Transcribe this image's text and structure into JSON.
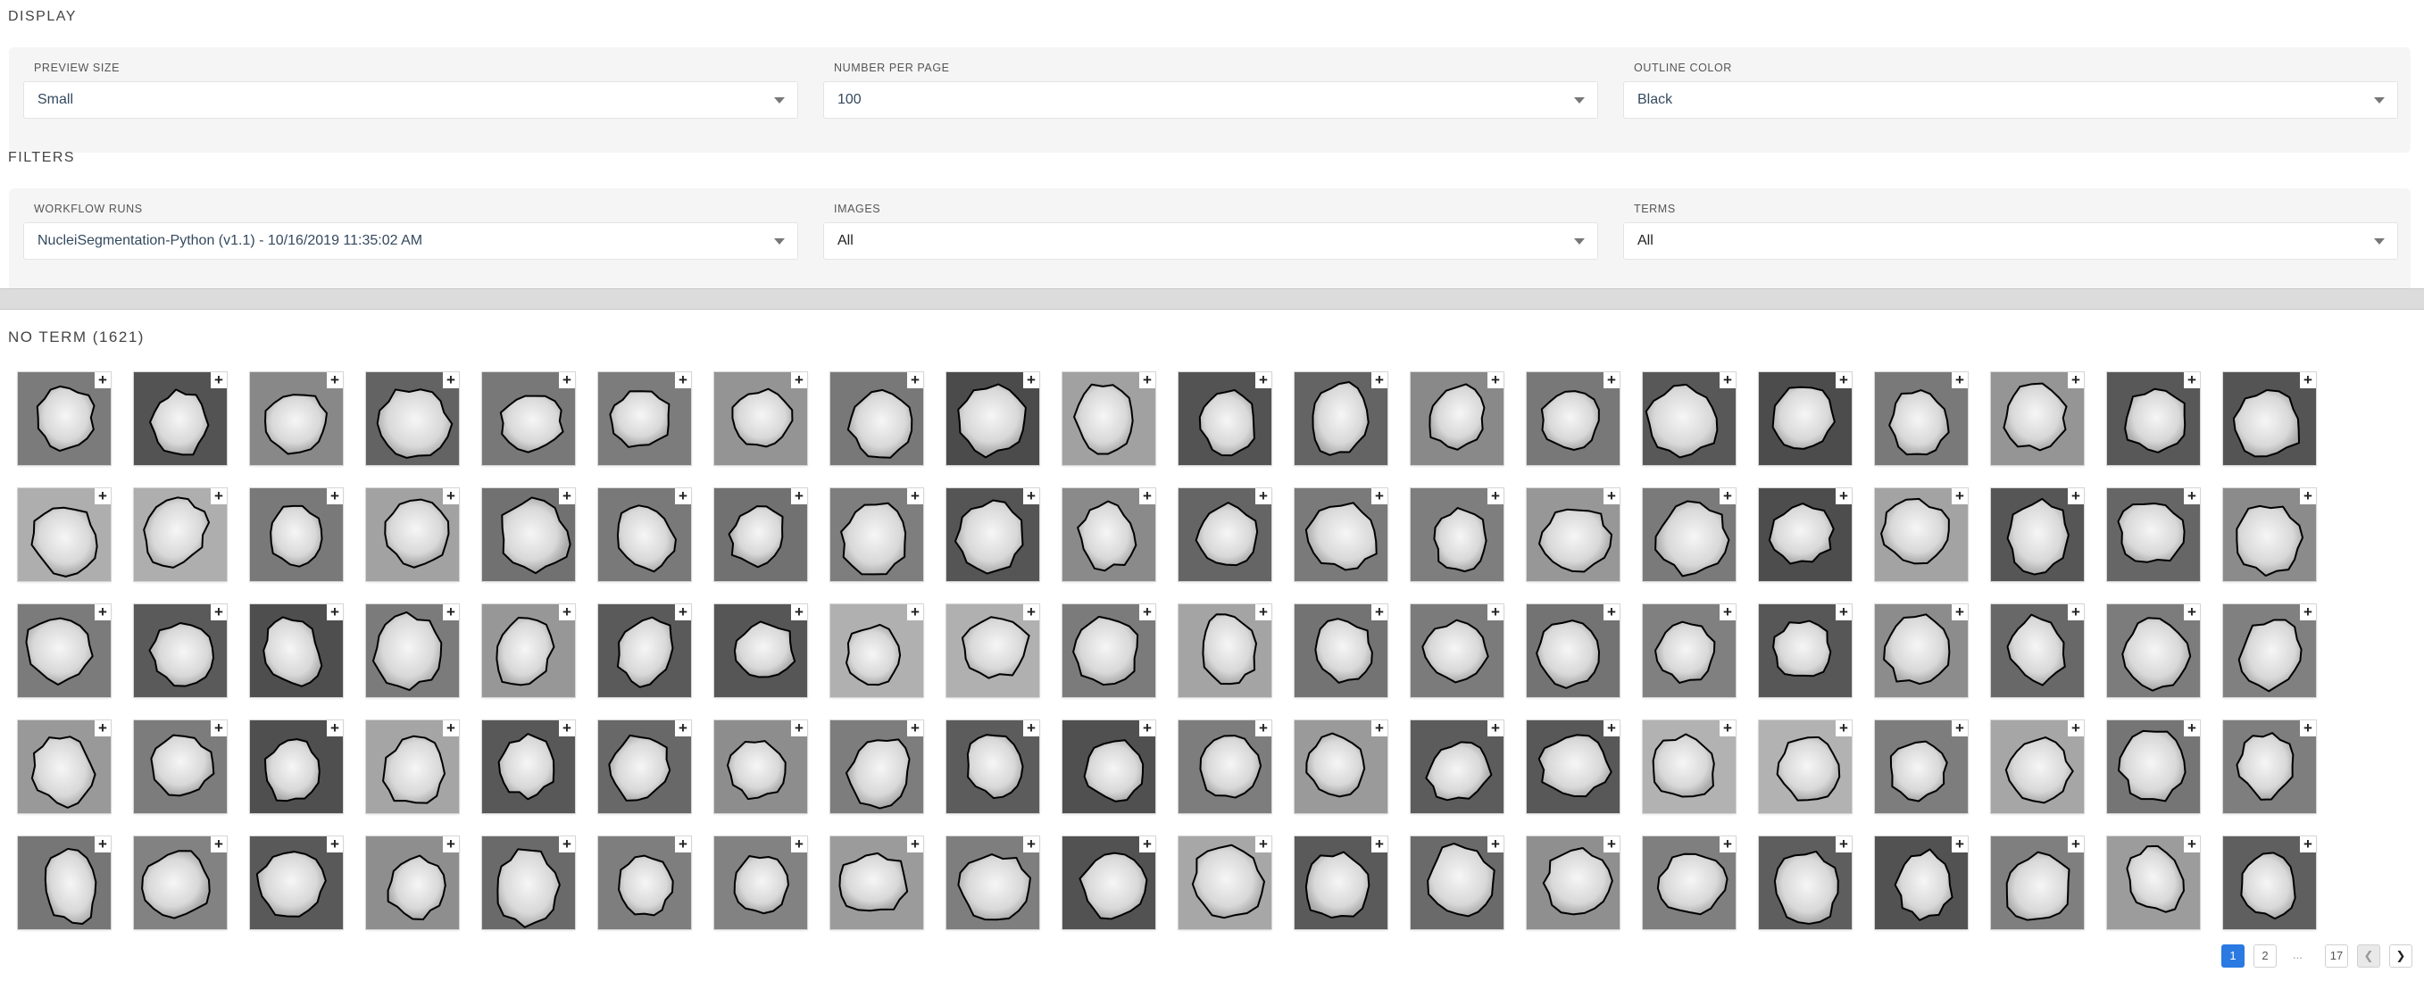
{
  "display": {
    "title": "DISPLAY",
    "preview_size": {
      "label": "PREVIEW SIZE",
      "value": "Small"
    },
    "number_per_page": {
      "label": "NUMBER PER PAGE",
      "value": "100"
    },
    "outline_color": {
      "label": "OUTLINE COLOR",
      "value": "Black"
    }
  },
  "filters": {
    "title": "FILTERS",
    "workflow_runs": {
      "label": "WORKFLOW RUNS",
      "value": "NucleiSegmentation-Python (v1.1) - 10/16/2019 11:35:02 AM"
    },
    "images": {
      "label": "IMAGES",
      "value": "All"
    },
    "terms": {
      "label": "TERMS",
      "value": "All"
    }
  },
  "term_group": {
    "title": "NO TERM (1621)",
    "visible_rows": 5,
    "visible_columns": 20,
    "add_icon": "plus-icon"
  },
  "pagination": {
    "pages": [
      "1",
      "2"
    ],
    "ellipsis": "...",
    "last": "17",
    "current": "1",
    "prev_icon": "chevron-left-icon",
    "next_icon": "chevron-right-icon"
  },
  "colors": {
    "accent": "#2a7ae2",
    "outline": "#000000"
  }
}
